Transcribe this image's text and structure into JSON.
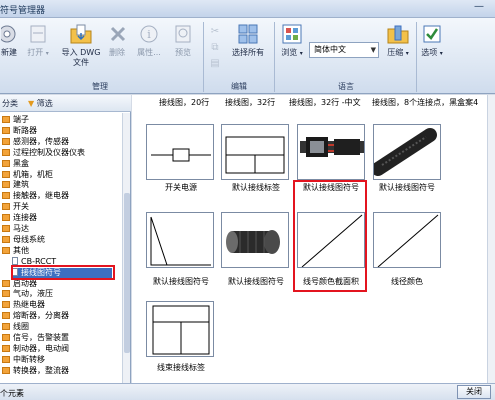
{
  "window": {
    "title": "符号管理器",
    "minimize_glyph": "—"
  },
  "ribbon": {
    "buttons": {
      "new": "新建",
      "open": "打开",
      "import_dwg": "导入 DWG 文件",
      "delete": "删除",
      "properties": "属性...",
      "preview": "预览",
      "select_all": "选择所有",
      "browse": "浏览",
      "compress": "压缩",
      "options": "选项"
    },
    "groups": {
      "manage": "管理",
      "edit": "编辑",
      "language": "语言"
    },
    "language_value": "简体中文",
    "icons": [
      "new-icon",
      "open-icon",
      "import-dwg-icon",
      "delete-icon",
      "properties-icon",
      "preview-icon",
      "select-all-icon",
      "browse-icon",
      "compress-icon",
      "options-icon"
    ]
  },
  "left": {
    "tabs": {
      "category": "分类",
      "filter": "筛选"
    },
    "tree": [
      {
        "label": "端子",
        "type": "folder"
      },
      {
        "label": "断路器",
        "type": "folder"
      },
      {
        "label": "感测器，传感器",
        "type": "folder"
      },
      {
        "label": "过程控制及仪器仪表",
        "type": "folder"
      },
      {
        "label": "黑盒",
        "type": "folder"
      },
      {
        "label": "机箱，机柜",
        "type": "folder"
      },
      {
        "label": "建筑",
        "type": "folder"
      },
      {
        "label": "接触器，继电器",
        "type": "folder"
      },
      {
        "label": "开关",
        "type": "folder"
      },
      {
        "label": "连接器",
        "type": "folder"
      },
      {
        "label": "马达",
        "type": "folder"
      },
      {
        "label": "母线系统",
        "type": "folder"
      },
      {
        "label": "其他",
        "type": "folder"
      },
      {
        "label": "CB-RCCT",
        "type": "doc"
      },
      {
        "label": "接线图符号",
        "type": "doc",
        "selected": true
      },
      {
        "label": "启动器",
        "type": "folder"
      },
      {
        "label": "气动，液压",
        "type": "folder"
      },
      {
        "label": "热继电器",
        "type": "folder"
      },
      {
        "label": "熔断器，分离器",
        "type": "folder"
      },
      {
        "label": "线圈",
        "type": "folder"
      },
      {
        "label": "信号，告警装置",
        "type": "folder"
      },
      {
        "label": "制动器，电动阀",
        "type": "folder"
      },
      {
        "label": "中断转移",
        "type": "folder"
      },
      {
        "label": "转换器，整流器",
        "type": "folder"
      }
    ]
  },
  "main": {
    "top_labels": [
      "接线图，20行",
      "接线图，32行",
      "接线图，32行 -中文",
      "接线图，8个连接点，黑盒案4"
    ],
    "cells": [
      {
        "caption": "开关电源",
        "icon": "switch-power-symbol-icon"
      },
      {
        "caption": "默认接线标签",
        "icon": "default-wiring-label-icon"
      },
      {
        "caption": "默认接线图符号",
        "icon": "cable-connector-photo-icon"
      },
      {
        "caption": "默认接线图符号",
        "icon": "corrugated-cable-photo-icon"
      },
      {
        "caption": "默认接线图符号",
        "icon": "default-wiring-symbol-icon"
      },
      {
        "caption": "默认接线图符号",
        "icon": "round-connector-photo-icon"
      },
      {
        "caption": "线号颜色截面积",
        "icon": "wire-color-cross-section-icon",
        "highlighted": true
      },
      {
        "caption": "线径颜色",
        "icon": "wire-diameter-color-icon"
      },
      {
        "caption": "线束接线标签",
        "icon": "harness-wiring-label-icon"
      }
    ]
  },
  "status": {
    "text": "个元素",
    "close": "关闭"
  },
  "colors": {
    "highlight": "#e3141f",
    "selection": "#3d6fc0",
    "folder": "#f2a33a"
  }
}
